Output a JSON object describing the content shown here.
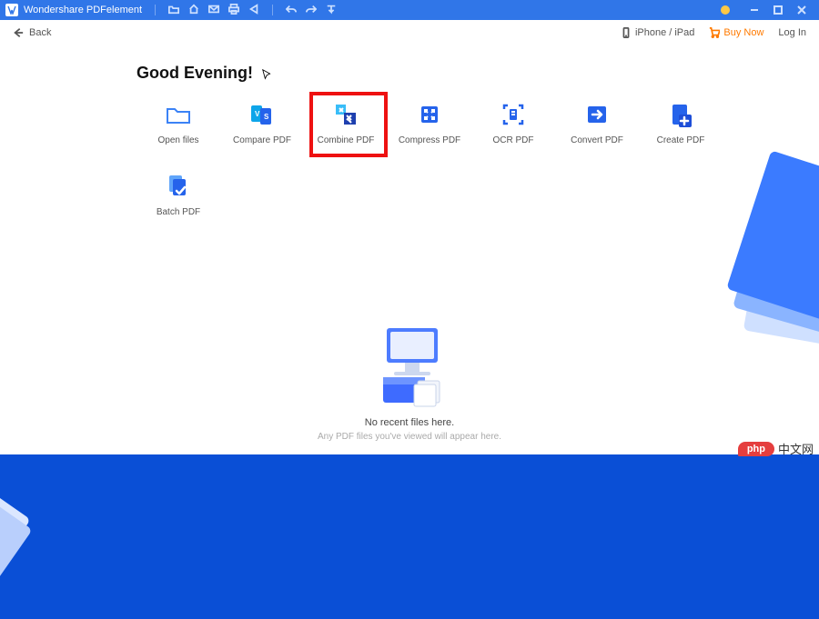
{
  "app": {
    "title": "Wondershare PDFelement"
  },
  "toolbar": {
    "back": "Back",
    "iphone": "iPhone / iPad",
    "buy": "Buy Now",
    "login": "Log In"
  },
  "greeting": "Good Evening!",
  "tiles": [
    {
      "name": "open-files",
      "label": "Open files",
      "icon": "folder"
    },
    {
      "name": "compare-pdf",
      "label": "Compare PDF",
      "icon": "compare"
    },
    {
      "name": "combine-pdf",
      "label": "Combine PDF",
      "icon": "combine",
      "highlight": true
    },
    {
      "name": "compress-pdf",
      "label": "Compress PDF",
      "icon": "compress"
    },
    {
      "name": "ocr-pdf",
      "label": "OCR PDF",
      "icon": "ocr"
    },
    {
      "name": "convert-pdf",
      "label": "Convert PDF",
      "icon": "convert"
    },
    {
      "name": "create-pdf",
      "label": "Create PDF",
      "icon": "create"
    },
    {
      "name": "batch-pdf",
      "label": "Batch PDF",
      "icon": "batch"
    }
  ],
  "empty": {
    "title": "No recent files here.",
    "subtitle": "Any PDF files you've viewed will appear here."
  },
  "watermark": {
    "brand": "php",
    "text": "中文网"
  }
}
